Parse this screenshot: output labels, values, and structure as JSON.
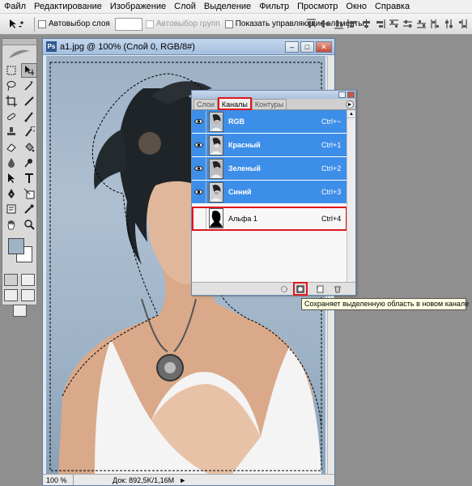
{
  "menu": [
    "Файл",
    "Редактирование",
    "Изображение",
    "Слой",
    "Выделение",
    "Фильтр",
    "Просмотр",
    "Окно",
    "Справка"
  ],
  "options": {
    "auto_select_layer": "Автовыбор слоя",
    "auto_select_groups": "Автовыбор групп",
    "show_controls": "Показать управляющие элементы"
  },
  "document": {
    "title": "a1.jpg @ 100% (Слой 0, RGB/8#)",
    "zoom": "100 %",
    "doc_info": "Док: 892,5K/1,16M"
  },
  "channels_panel": {
    "tabs": [
      "Слои",
      "Каналы",
      "Контуры"
    ],
    "active_tab": "Каналы",
    "channels": [
      {
        "name": "RGB",
        "shortcut": "Ctrl+~",
        "selected": true,
        "visible": true
      },
      {
        "name": "Красный",
        "shortcut": "Ctrl+1",
        "selected": true,
        "visible": true
      },
      {
        "name": "Зеленый",
        "shortcut": "Ctrl+2",
        "selected": true,
        "visible": true
      },
      {
        "name": "Синий",
        "shortcut": "Ctrl+3",
        "selected": true,
        "visible": true
      },
      {
        "name": "Альфа 1",
        "shortcut": "Ctrl+4",
        "selected": false,
        "visible": false
      }
    ]
  },
  "tooltip": "Сохраняет выделенную область в новом канале",
  "colors": {
    "selected_row": "#3d8ee8",
    "highlight": "#e0161c",
    "foreground_color": "#9fb4c9",
    "background_color": "#ffffff"
  }
}
